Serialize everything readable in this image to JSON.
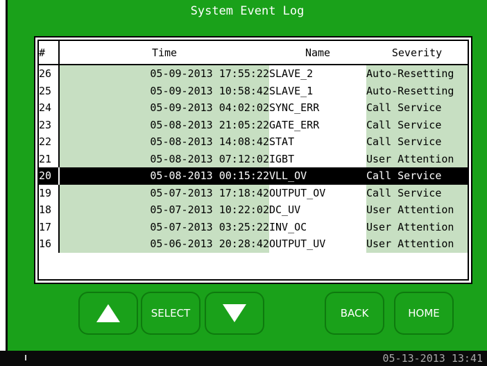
{
  "title": "System Event Log",
  "columns": [
    "#",
    "Time",
    "Name",
    "Severity"
  ],
  "events": [
    {
      "num": "26",
      "time": "05-09-2013 17:55:22",
      "name": "SLAVE_2",
      "severity": "Auto-Resetting"
    },
    {
      "num": "25",
      "time": "05-09-2013 10:58:42",
      "name": "SLAVE_1",
      "severity": "Auto-Resetting"
    },
    {
      "num": "24",
      "time": "05-09-2013 04:02:02",
      "name": "SYNC_ERR",
      "severity": "Call Service"
    },
    {
      "num": "23",
      "time": "05-08-2013 21:05:22",
      "name": "GATE_ERR",
      "severity": "Call Service"
    },
    {
      "num": "22",
      "time": "05-08-2013 14:08:42",
      "name": "STAT",
      "severity": "Call Service"
    },
    {
      "num": "21",
      "time": "05-08-2013 07:12:02",
      "name": "IGBT",
      "severity": "User Attention"
    },
    {
      "num": "20",
      "time": "05-08-2013 00:15:22",
      "name": "VLL_OV",
      "severity": "Call Service",
      "selected": true
    },
    {
      "num": "19",
      "time": "05-07-2013 17:18:42",
      "name": "OUTPUT_OV",
      "severity": "Call Service"
    },
    {
      "num": "18",
      "time": "05-07-2013 10:22:02",
      "name": "DC_UV",
      "severity": "User Attention"
    },
    {
      "num": "17",
      "time": "05-07-2013 03:25:22",
      "name": "INV_OC",
      "severity": "User Attention"
    },
    {
      "num": "16",
      "time": "05-06-2013 20:28:42",
      "name": "OUTPUT_UV",
      "severity": "User Attention"
    }
  ],
  "buttons": {
    "up_icon": "triangle-up-icon",
    "select_label": "SELECT",
    "down_icon": "triangle-down-icon",
    "back_label": "BACK",
    "home_label": "HOME"
  },
  "status": {
    "clock": "05-13-2013 13:41"
  },
  "colors": {
    "panel_green": "#1aa11a",
    "cell_green": "#c7dfc2",
    "selected_row": "#000000"
  }
}
